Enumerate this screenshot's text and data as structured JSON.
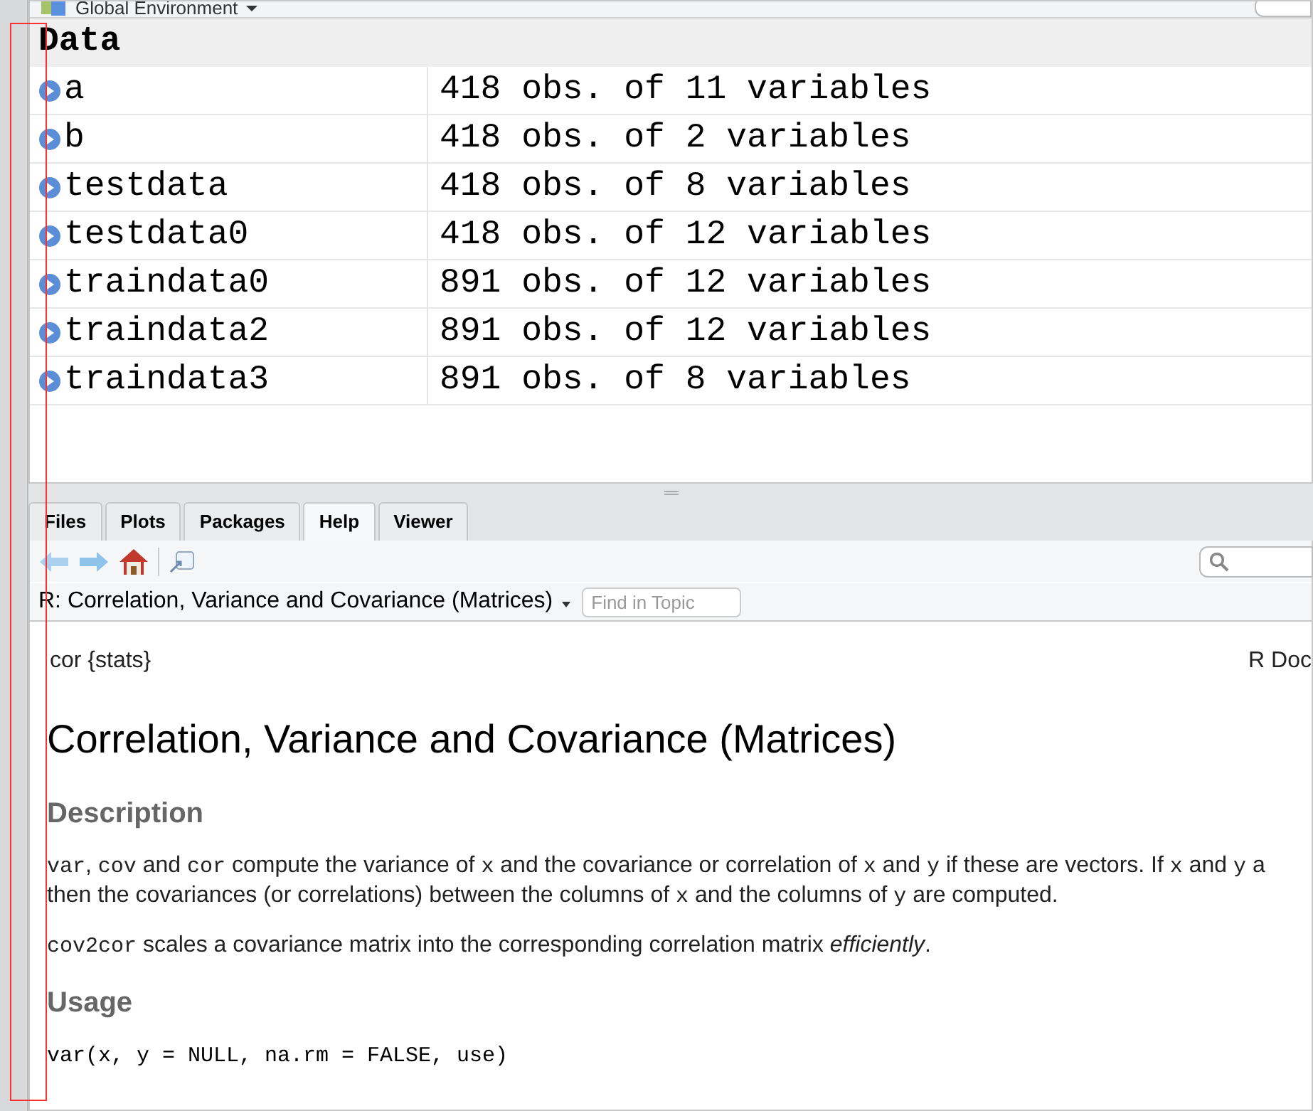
{
  "environment": {
    "label": "Global Environment"
  },
  "data_section": {
    "title": "Data",
    "rows": [
      {
        "name": "a",
        "value": "418 obs. of 11 variables"
      },
      {
        "name": "b",
        "value": "418 obs. of 2 variables"
      },
      {
        "name": "testdata",
        "value": "418 obs. of 8 variables"
      },
      {
        "name": "testdata0",
        "value": "418 obs. of 12 variables"
      },
      {
        "name": "traindata0",
        "value": "891 obs. of 12 variables"
      },
      {
        "name": "traindata2",
        "value": "891 obs. of 12 variables"
      },
      {
        "name": "traindata3",
        "value": "891 obs. of 8 variables"
      }
    ]
  },
  "tabs": [
    {
      "label": "Files",
      "selected": false
    },
    {
      "label": "Plots",
      "selected": false
    },
    {
      "label": "Packages",
      "selected": false
    },
    {
      "label": "Help",
      "selected": true
    },
    {
      "label": "Viewer",
      "selected": false
    }
  ],
  "help": {
    "topic": "R: Correlation, Variance and Covariance (Matrices)",
    "find_placeholder": "Find in Topic",
    "package": "cor {stats}",
    "doc_label": "R Doc",
    "title": "Correlation, Variance and Covariance (Matrices)",
    "sections": [
      {
        "kind": "heading",
        "text": "Description"
      },
      {
        "kind": "paragraph",
        "lines": [
          [
            {
              "kind": "code",
              "text": "var"
            },
            {
              "kind": "text",
              "text": ", "
            },
            {
              "kind": "code",
              "text": "cov"
            },
            {
              "kind": "text",
              "text": " and "
            },
            {
              "kind": "code",
              "text": "cor"
            },
            {
              "kind": "text",
              "text": " compute the variance of "
            },
            {
              "kind": "code",
              "text": "x"
            },
            {
              "kind": "text",
              "text": " and the covariance or correlation of "
            },
            {
              "kind": "code",
              "text": "x"
            },
            {
              "kind": "text",
              "text": " and "
            },
            {
              "kind": "code",
              "text": "y"
            },
            {
              "kind": "text",
              "text": " if these are vectors. If "
            },
            {
              "kind": "code",
              "text": "x"
            },
            {
              "kind": "text",
              "text": " and "
            },
            {
              "kind": "code",
              "text": "y"
            },
            {
              "kind": "text",
              "text": " a"
            }
          ],
          [
            {
              "kind": "text",
              "text": "then the covariances (or correlations) between the columns of "
            },
            {
              "kind": "code",
              "text": "x"
            },
            {
              "kind": "text",
              "text": " and the columns of "
            },
            {
              "kind": "code",
              "text": "y"
            },
            {
              "kind": "text",
              "text": " are computed."
            }
          ]
        ]
      },
      {
        "kind": "paragraph",
        "lines": [
          [
            {
              "kind": "code",
              "text": "cov2cor"
            },
            {
              "kind": "text",
              "text": " scales a covariance matrix into the corresponding correlation matrix "
            },
            {
              "kind": "em",
              "text": "efficiently"
            },
            {
              "kind": "text",
              "text": "."
            }
          ]
        ]
      },
      {
        "kind": "heading",
        "text": "Usage"
      },
      {
        "kind": "code_block",
        "text": "var(x, y = NULL, na.rm = FALSE, use)"
      }
    ]
  }
}
